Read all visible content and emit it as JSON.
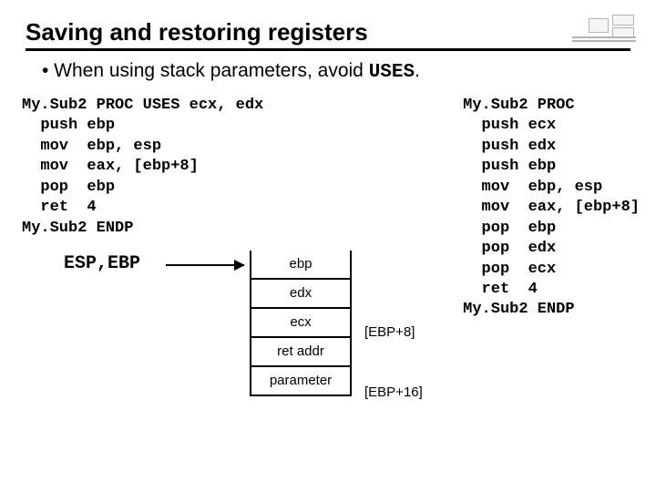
{
  "title": "Saving and restoring registers",
  "bullet_prefix": "• When using stack parameters, avoid ",
  "bullet_code": "USES",
  "bullet_suffix": ".",
  "code_left": "My.Sub2 PROC USES ecx, edx\n  push ebp\n  mov  ebp, esp\n  mov  eax, [ebp+8]\n  pop  ebp\n  ret  4\nMy.Sub2 ENDP",
  "code_right": "My.Sub2 PROC\n  push ecx\n  push edx\n  push ebp\n  mov  ebp, esp\n  mov  eax, [ebp+8]\n  pop  ebp\n  pop  edx\n  pop  ecx\n  ret  4\nMy.Sub2 ENDP",
  "pointer_label": "ESP,EBP",
  "stack_cells": [
    "ebp",
    "edx",
    "ecx",
    "ret addr",
    "parameter"
  ],
  "offsets": {
    "ebp8": "[EBP+8]",
    "ebp16": "[EBP+16]"
  }
}
